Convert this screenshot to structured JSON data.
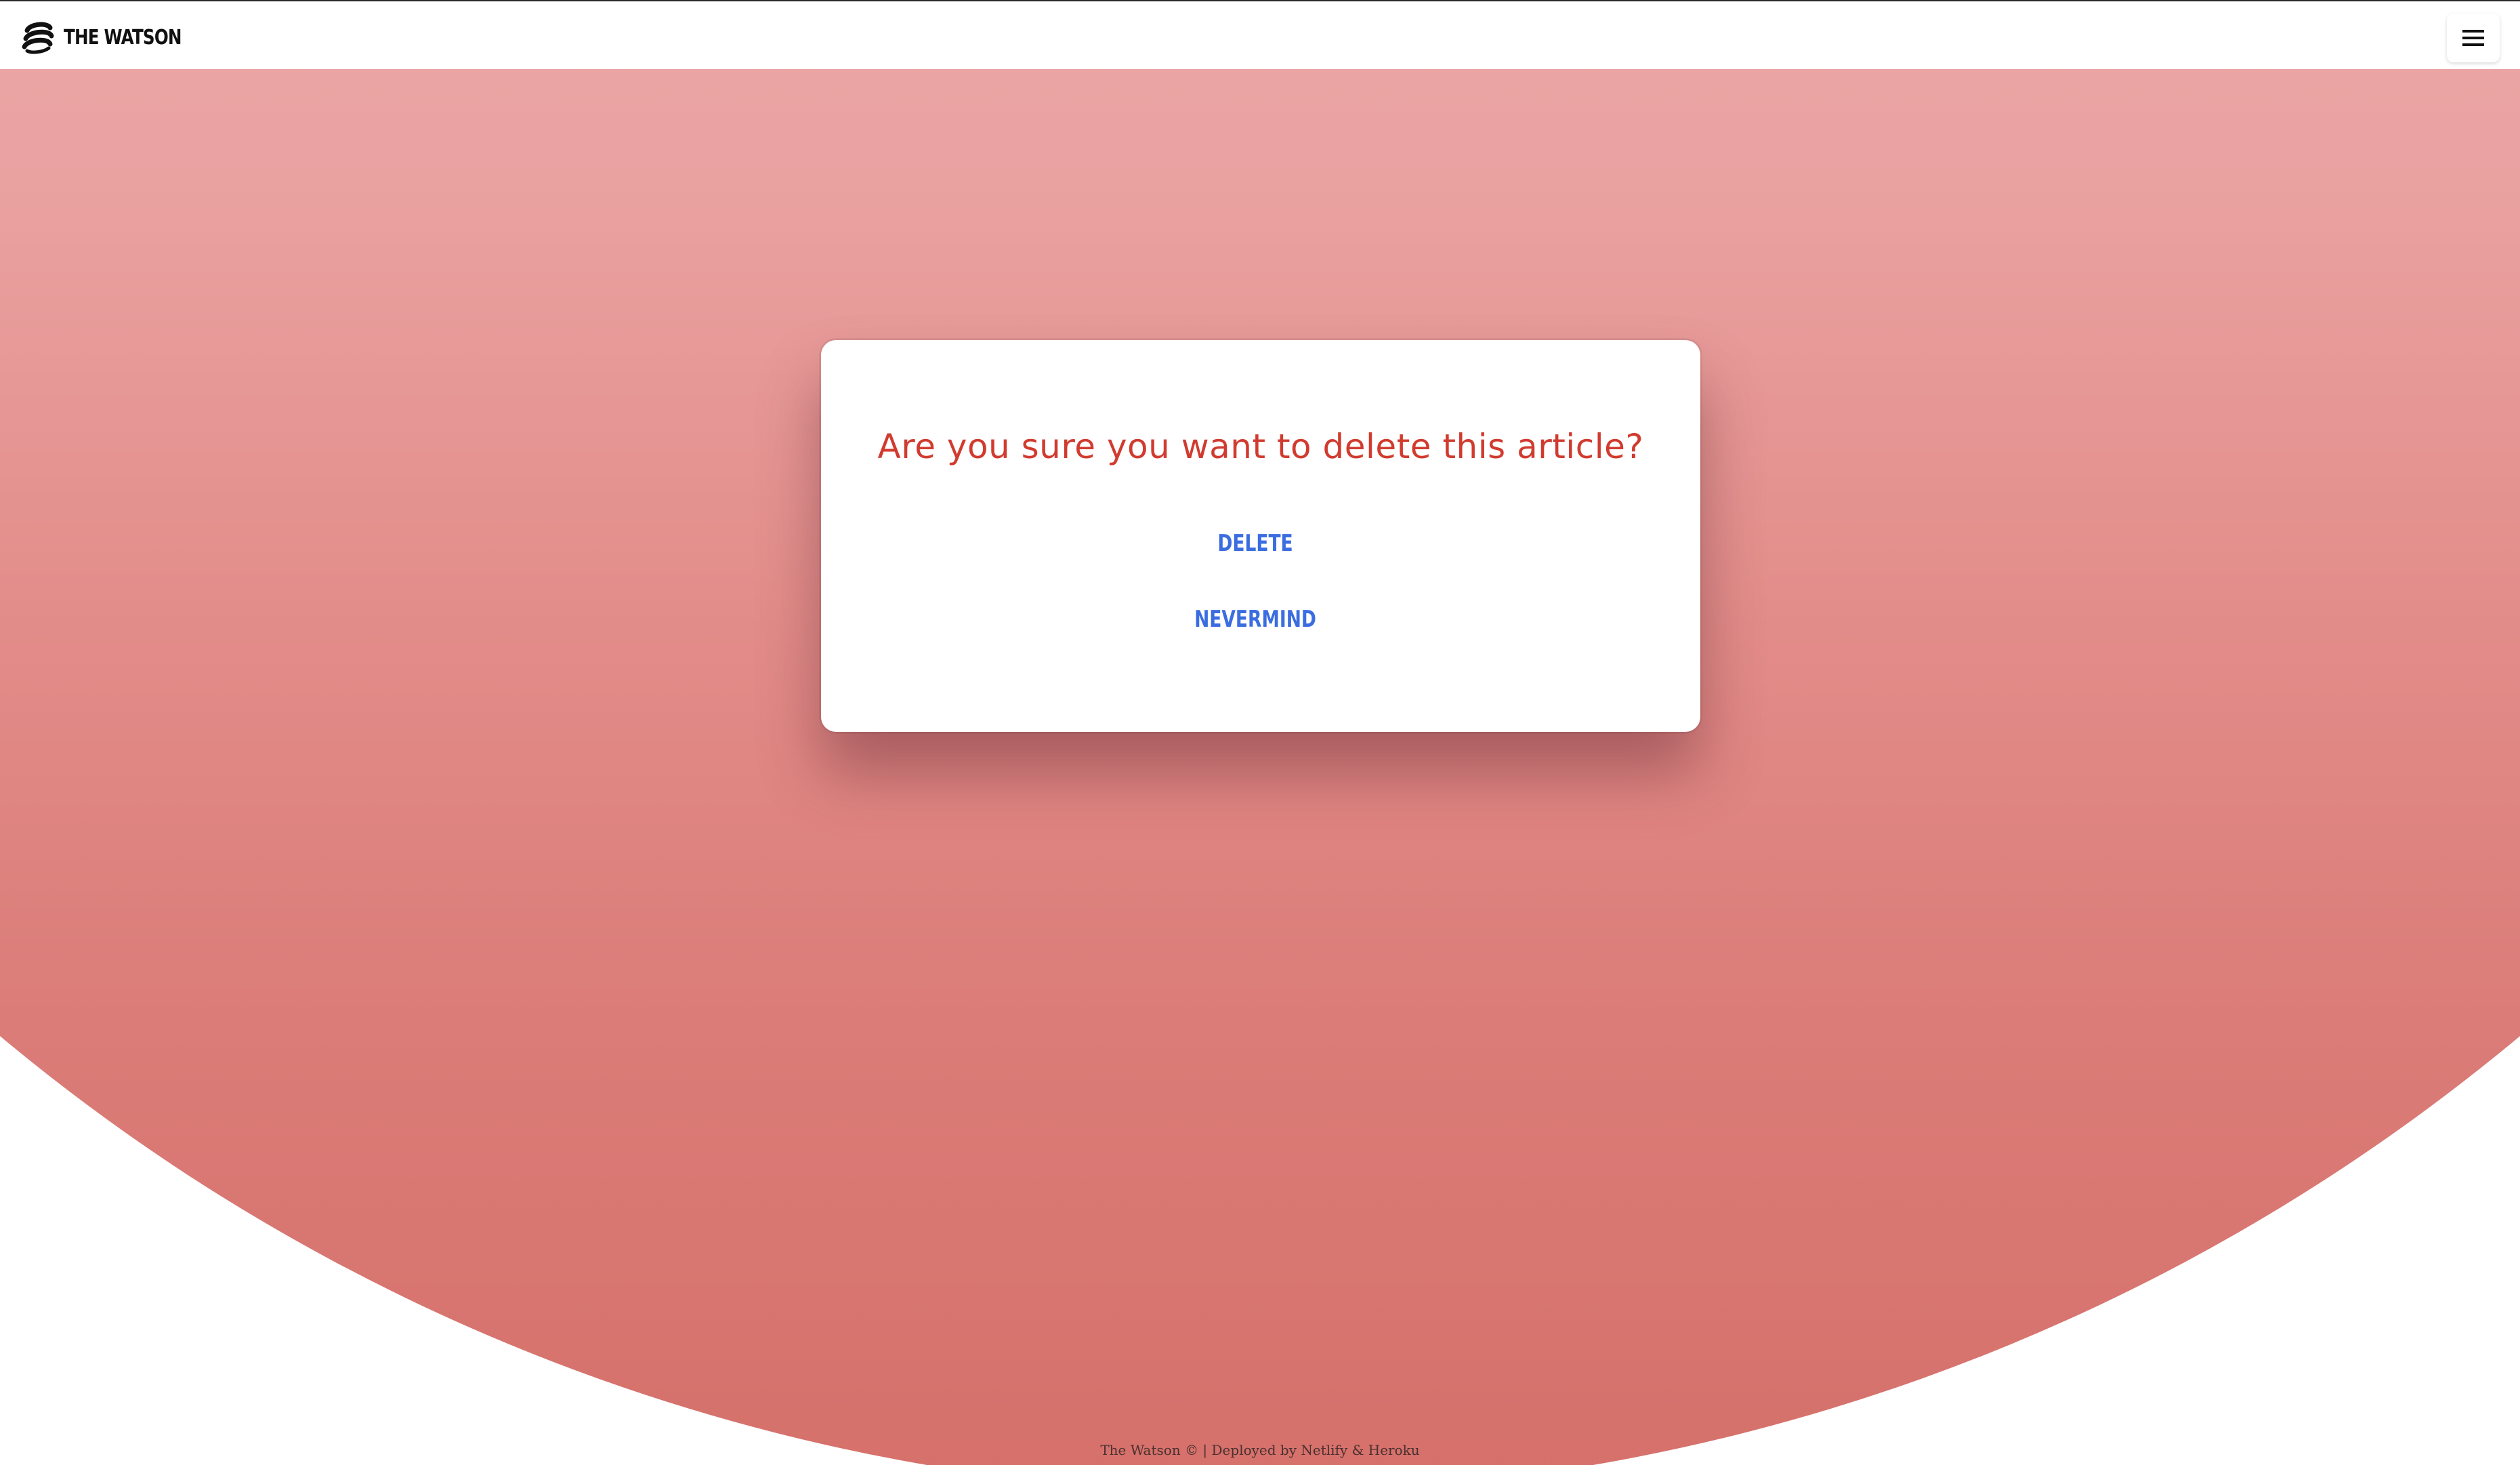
{
  "navbar": {
    "brand_name": "THE WATSON",
    "logo_icon": "swirl-logo-icon",
    "menu_icon": "hamburger-menu-icon"
  },
  "dialog": {
    "title": "Are you sure you want to delete this article?",
    "delete_label": "DELETE",
    "nevermind_label": "NEVERMIND"
  },
  "footer": {
    "text": "The Watson © | Deployed by Netlify & Heroku"
  },
  "colors": {
    "title": "#d13b2f",
    "button_text": "#3b6de0",
    "background_gradient_top": "#f1b8b8",
    "background_gradient_bottom": "#d5706a"
  }
}
